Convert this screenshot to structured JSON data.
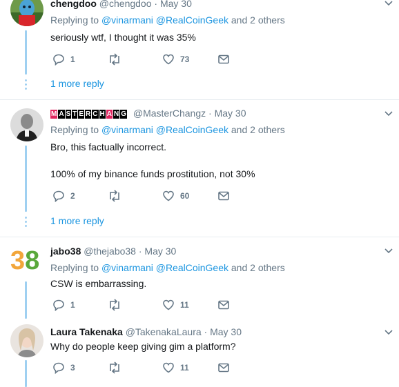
{
  "tweets": [
    {
      "name": "chengdoo",
      "handle": "@chengdoo",
      "dot": "·",
      "time": "May 30",
      "reply_prefix": "Replying to",
      "mention1": "@vinarmani",
      "mention2": "@RealCoinGeek",
      "reply_suffix": "and 2 others",
      "text1": "seriously wtf, I thought it was 35%",
      "replies": "1",
      "retweets": "",
      "likes": "73",
      "more": "1 more reply"
    },
    {
      "name_letters": [
        "M",
        "A",
        "S",
        "T",
        "E",
        "R",
        "C",
        "H",
        "A",
        "N",
        "G"
      ],
      "handle": "@MasterChangz",
      "dot": "·",
      "time": "May 30",
      "reply_prefix": "Replying to",
      "mention1": "@vinarmani",
      "mention2": "@RealCoinGeek",
      "reply_suffix": "and 2 others",
      "text1": "Bro, this factually incorrect.",
      "text2": "100% of my binance funds prostitution, not 30%",
      "replies": "2",
      "retweets": "",
      "likes": "60",
      "more": "1 more reply"
    },
    {
      "avatar_digits": "38",
      "name": "jabo38",
      "handle": "@thejabo38",
      "dot": "·",
      "time": "May 30",
      "reply_prefix": "Replying to",
      "mention1": "@vinarmani",
      "mention2": "@RealCoinGeek",
      "reply_suffix": "and 2 others",
      "text1": "CSW is embarrassing.",
      "replies": "1",
      "retweets": "",
      "likes": "11"
    },
    {
      "name": "Laura Takenaka",
      "handle": "@TakenakaLaura",
      "dot": "·",
      "time": "May 30",
      "text1": "Why do people keep giving gim a platform?",
      "replies": "3",
      "retweets": "",
      "likes": "11"
    }
  ],
  "colors": {
    "link": "#1b95e0",
    "muted": "#657786",
    "thread": "#9fd0f1"
  },
  "icons": [
    "reply-icon",
    "retweet-icon",
    "like-icon",
    "dm-icon",
    "chevron-down-icon"
  ]
}
